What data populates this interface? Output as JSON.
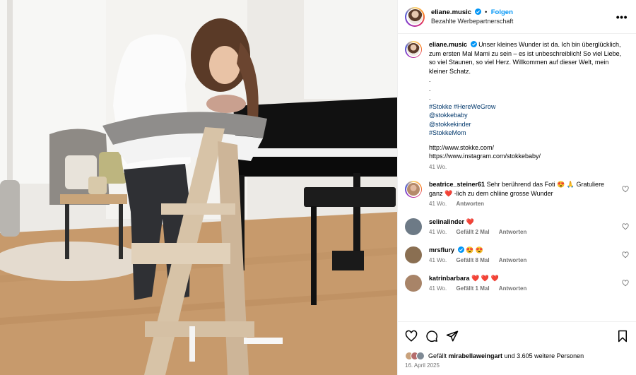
{
  "header": {
    "username": "eliane.music",
    "follow_label": "Folgen",
    "dot": "•",
    "subtitle": "Bezahlte Werbepartnerschaft",
    "more_label": "•••"
  },
  "caption": {
    "username": "eliane.music",
    "text": "Unser kleines Wunder ist da. Ich bin überglücklich, zum ersten Mal Mami zu sein – es ist unbeschreiblich! So viel Liebe, so viel Staunen, so viel Herz. Willkommen auf dieser Welt, mein kleiner Schatz.",
    "dots": [
      ".",
      ".",
      "."
    ],
    "hashtags": "#Stokke #HereWeGrow",
    "mentions": [
      "@stokkebaby",
      "@stokkekinder",
      "#StokkeMom"
    ],
    "links": [
      "http://www.stokke.com/",
      "https://www.instagram.com/stokkebaby/"
    ],
    "time": "41 Wo."
  },
  "comments": [
    {
      "username": "beatrice_steiner61",
      "text_a": "Sehr berührend das Foti 😍 🙏 Gratuliere ganz ❤️ -lich zu dem chliine grosse Wunder",
      "time": "41 Wo.",
      "likes": "",
      "reply": "Antworten",
      "avatar_color": "#b58a6a"
    },
    {
      "username": "selinalinder",
      "text_a": "❤️",
      "time": "41 Wo.",
      "likes": "Gefällt 2 Mal",
      "reply": "Antworten",
      "avatar_color": "#6d7a86"
    },
    {
      "username": "mrsflury",
      "text_a": "😍 😍",
      "time": "41 Wo.",
      "likes": "Gefällt 8 Mal",
      "reply": "Antworten",
      "avatar_color": "#8a6f52"
    },
    {
      "username": "katrinbarbara",
      "text_a": "❤️ ❤️ ❤️",
      "time": "41 Wo.",
      "likes": "Gefällt 1 Mal",
      "reply": "Antworten",
      "avatar_color": "#a88468"
    }
  ],
  "footer": {
    "likes_prefix": "Gefällt",
    "likes_user": "mirabellaweingart",
    "likes_suffix": "und 3.605 weitere Personen",
    "date": "16. April 2025"
  },
  "colors": {
    "accent": "#0095f6",
    "link": "#00376b",
    "muted": "#737373"
  },
  "icons": [
    "verified-badge-icon",
    "heart-icon",
    "comment-icon",
    "share-icon",
    "bookmark-icon",
    "more-icon"
  ]
}
